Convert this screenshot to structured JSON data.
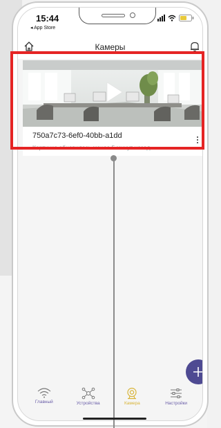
{
  "status_bar": {
    "time": "15:44",
    "back_label": "◂ App Store"
  },
  "header": {
    "title": "Камеры",
    "home_icon": "home-icon",
    "bell_icon": "bell-icon"
  },
  "camera_card": {
    "name": "750a7c73-6ef0-40bb-a1dd",
    "status": "Картинка обновилась менее 5 минут назад",
    "play_icon": "play-icon",
    "more_icon": "more-vertical-icon"
  },
  "fab": {
    "icon": "plus-icon"
  },
  "tabs": [
    {
      "label": "Главный",
      "icon": "wifi-signal-icon",
      "active": false
    },
    {
      "label": "Устройства",
      "icon": "devices-network-icon",
      "active": false
    },
    {
      "label": "Камера",
      "icon": "camera-icon",
      "active": true
    },
    {
      "label": "Настройки",
      "icon": "settings-sliders-icon",
      "active": false
    }
  ],
  "colors": {
    "accent": "#4e4a92",
    "active_tab": "#d8b437",
    "highlight": "#e52424"
  }
}
